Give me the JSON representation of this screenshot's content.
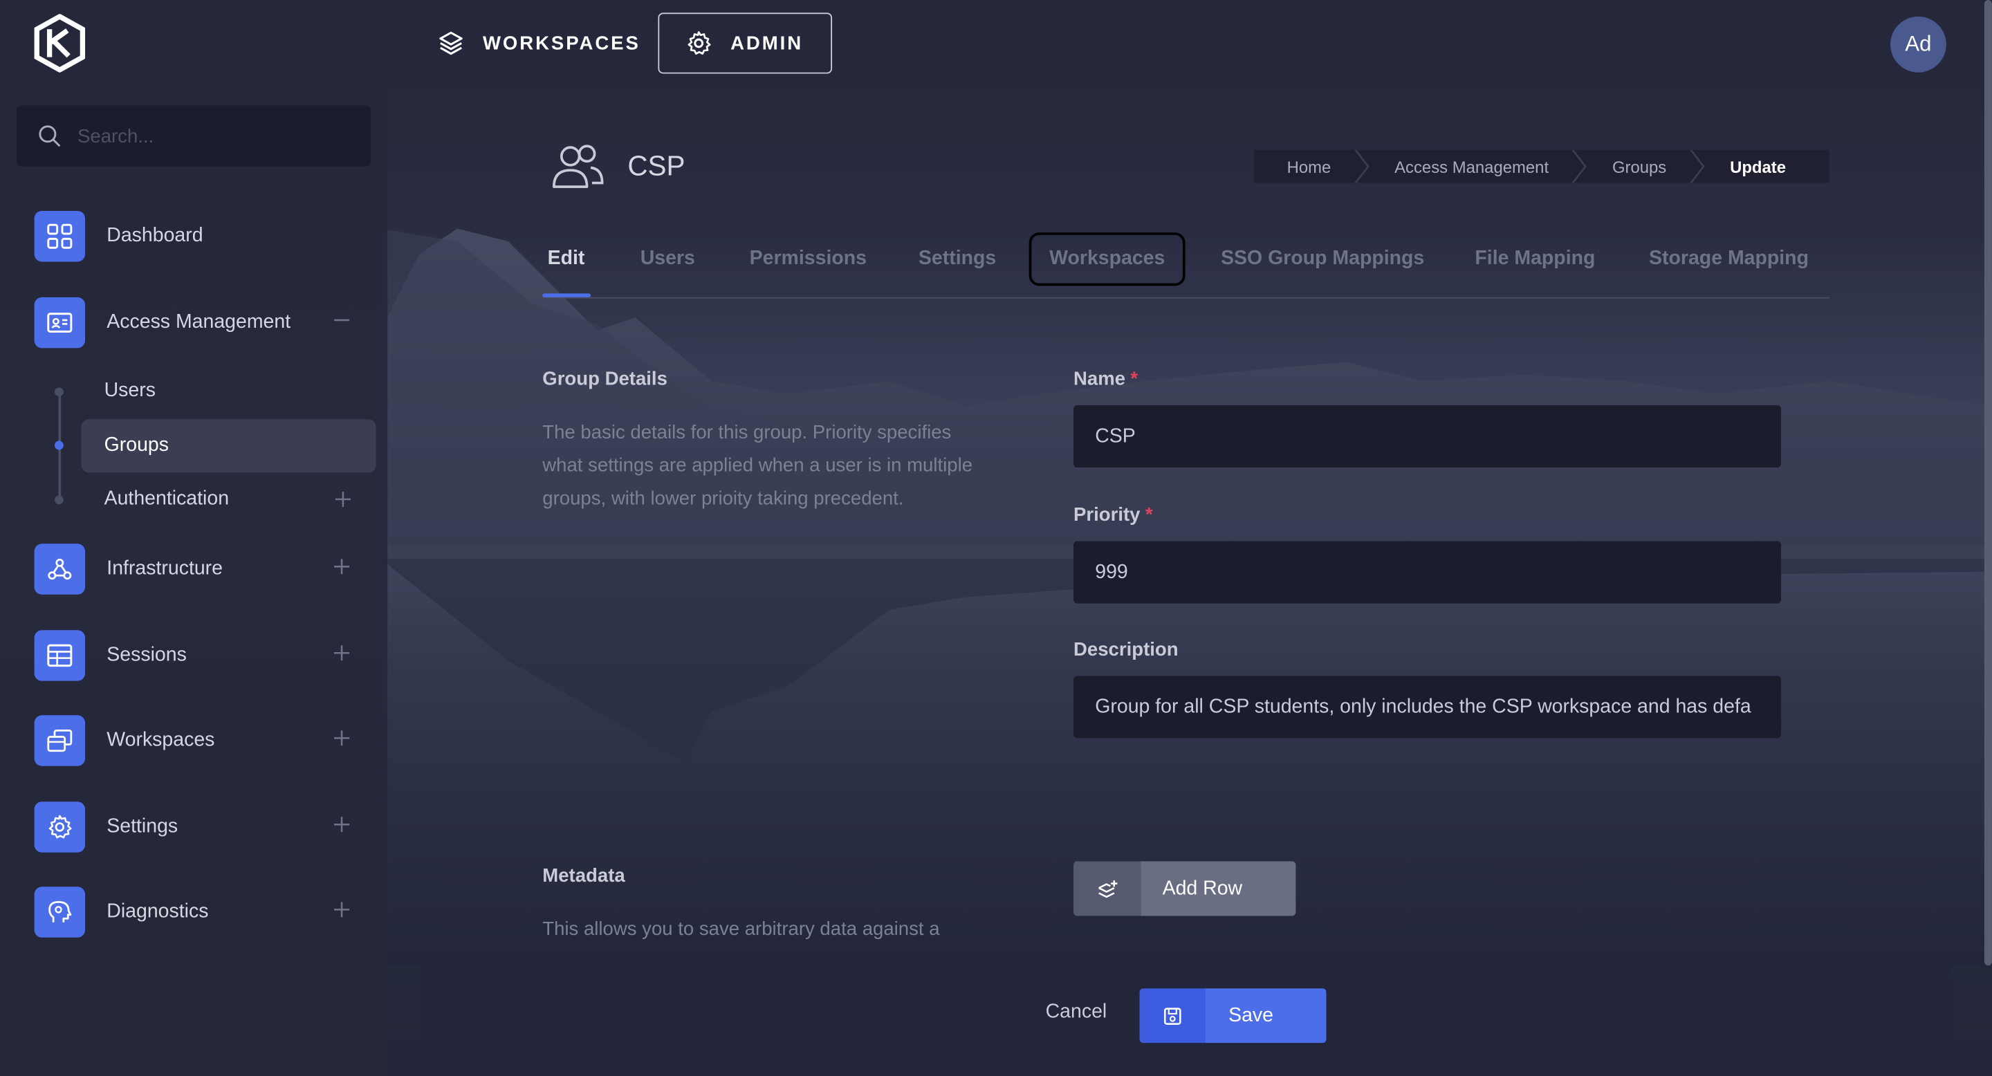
{
  "topbar": {
    "nav_workspaces": "WORKSPACES",
    "nav_admin": "ADMIN",
    "avatar": "Ad"
  },
  "sidebar": {
    "search_placeholder": "Search...",
    "items": [
      {
        "label": "Dashboard",
        "icon": "grid-icon"
      },
      {
        "label": "Access Management",
        "icon": "id-card-icon"
      },
      {
        "label": "Infrastructure",
        "icon": "network-icon"
      },
      {
        "label": "Sessions",
        "icon": "table-icon"
      },
      {
        "label": "Workspaces",
        "icon": "windows-icon"
      },
      {
        "label": "Settings",
        "icon": "gear-icon"
      },
      {
        "label": "Diagnostics",
        "icon": "brain-icon"
      }
    ],
    "sub_items": [
      {
        "label": "Users"
      },
      {
        "label": "Groups"
      },
      {
        "label": "Authentication"
      }
    ]
  },
  "page": {
    "title": "CSP",
    "breadcrumb": [
      "Home",
      "Access Management",
      "Groups",
      "Update"
    ]
  },
  "tabs": [
    "Edit",
    "Users",
    "Permissions",
    "Settings",
    "Workspaces",
    "SSO Group Mappings",
    "File Mapping",
    "Storage Mapping"
  ],
  "group_details": {
    "title": "Group Details",
    "description": "The basic details for this group. Priority specifies what settings are applied when a user is in multiple groups, with lower prioity taking precedent."
  },
  "form": {
    "name_label": "Name",
    "name_value": "CSP",
    "priority_label": "Priority",
    "priority_value": "999",
    "description_label": "Description",
    "description_value": "Group for all CSP students, only includes the CSP workspace and has defa",
    "required_marker": "*"
  },
  "metadata": {
    "title": "Metadata",
    "description": "This allows you to save arbitrary data against a",
    "add_row_label": "Add Row"
  },
  "footer": {
    "cancel_label": "Cancel",
    "save_label": "Save"
  },
  "colors": {
    "accent": "#4d6ee9",
    "background": "#232538",
    "required": "#e0425e"
  }
}
